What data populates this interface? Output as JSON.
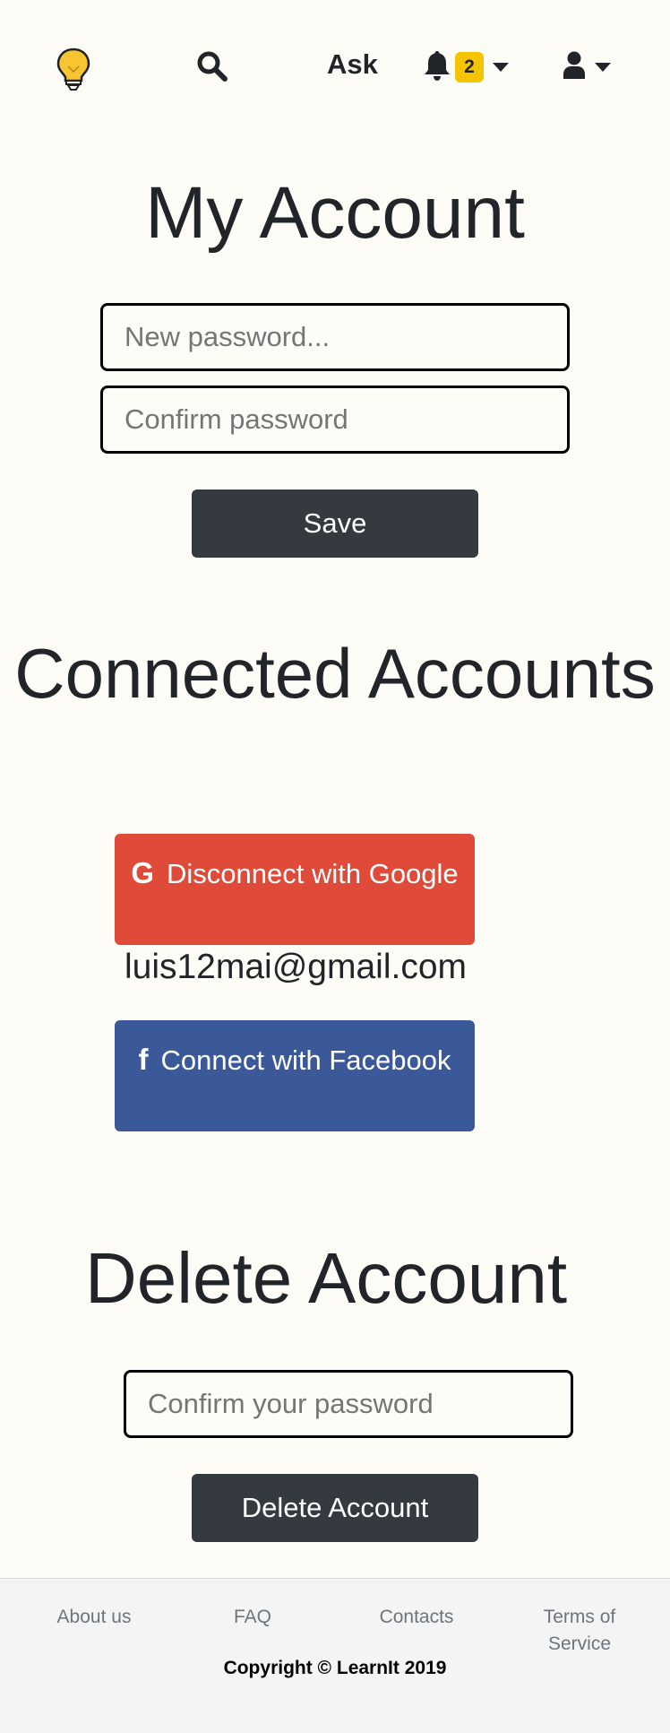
{
  "nav": {
    "logo_icon": "lightbulb-icon",
    "search_icon": "search-icon",
    "ask_label": "Ask",
    "bell_icon": "bell-icon",
    "notification_count": "2",
    "badge_color": "#f5c400",
    "user_icon": "user-icon"
  },
  "account": {
    "title": "My Account",
    "new_password_placeholder": "New password...",
    "confirm_password_placeholder": "Confirm password",
    "save_label": "Save"
  },
  "connected": {
    "title": "Connected Accounts",
    "google": {
      "icon": "google-icon",
      "icon_glyph": "G",
      "label": "Disconnect with Google",
      "color": "#df4b38",
      "email": "luis12mai@gmail.com"
    },
    "facebook": {
      "icon": "facebook-icon",
      "icon_glyph": "f",
      "label": "Connect with Facebook",
      "color": "#3b5998"
    }
  },
  "delete": {
    "title": "Delete Account",
    "confirm_placeholder": "Confirm your password",
    "button_label": "Delete Account"
  },
  "footer": {
    "links": [
      "About us",
      "FAQ",
      "Contacts",
      "Terms of Service"
    ],
    "copyright": "Copyright © LearnIt 2019"
  }
}
